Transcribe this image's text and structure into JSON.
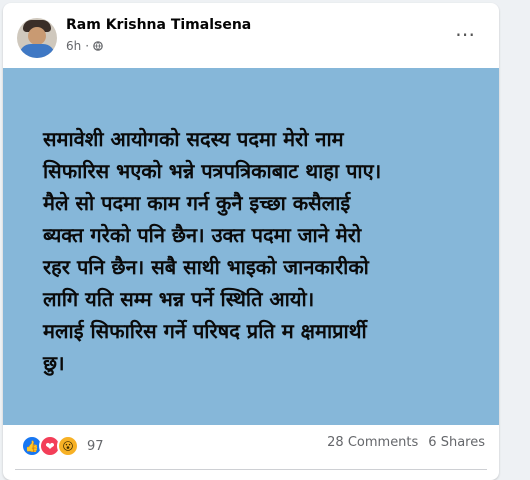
{
  "post": {
    "author": "Ram Krishna Timalsena",
    "time": "6h",
    "separator": "·",
    "more_icon": "⋯",
    "lines": [
      "समावेशी आयोगको सदस्य पदमा मेरो नाम",
      "सिफारिस भएको भन्ने पत्रपत्रिकाबाट थाहा पाए।",
      "मैले सो पदमा काम गर्न कुनै इच्छा कसैलाई",
      "ब्यक्त गरेको पनि छैन। उक्त पदमा जाने मेरो",
      "रहर पनि छैन। सबै साथी भाइको जानकारीको",
      "लागि यति सम्म भन्न पर्ने स्थिति आयो।",
      "मलाई सिफारिस गर्ने परिषद प्रति म क्षमाप्रार्थी",
      "छु।"
    ],
    "background_color": "#86b7d9"
  },
  "engagement": {
    "reaction_icons": [
      "like-icon",
      "love-icon",
      "wow-icon"
    ],
    "reaction_glyphs": [
      "👍",
      "❤",
      "😮"
    ],
    "reaction_count": "97",
    "comments": "28 Comments",
    "shares": "6 Shares"
  }
}
